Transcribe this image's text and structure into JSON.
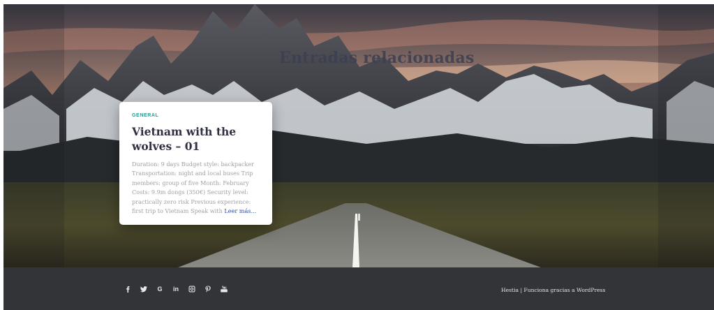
{
  "section": {
    "title": "Entradas relacionadas"
  },
  "card": {
    "category": "GENERAL",
    "title": "Vietnam with the wolves – 01",
    "excerpt": "Duration: 9 days Budget style: backpacker Transportation: night and local buses Trip members: group of five Month: February Costs: 9.9m dongs (350€) Security level: practically zero risk Previous experience: first trip to Vietnam Speak with",
    "read_more": "Leer más..."
  },
  "footer": {
    "social": [
      {
        "icon": "facebook-icon",
        "glyph": "f"
      },
      {
        "icon": "twitter-icon",
        "glyph": "twitter"
      },
      {
        "icon": "google-icon",
        "glyph": "G"
      },
      {
        "icon": "linkedin-icon",
        "glyph": "in"
      },
      {
        "icon": "instagram-icon",
        "glyph": "instagram"
      },
      {
        "icon": "pinterest-icon",
        "glyph": "P"
      },
      {
        "icon": "youtube-icon",
        "glyph": "youtube"
      }
    ],
    "credits_brand": "Hestia",
    "credits_separator": " | ",
    "credits_text": "Funciona gracias a WordPress"
  },
  "colors": {
    "accent": "#2e9a8c",
    "link": "#2a4aa0",
    "footer_bg": "#323437",
    "title": "#2f3042"
  }
}
